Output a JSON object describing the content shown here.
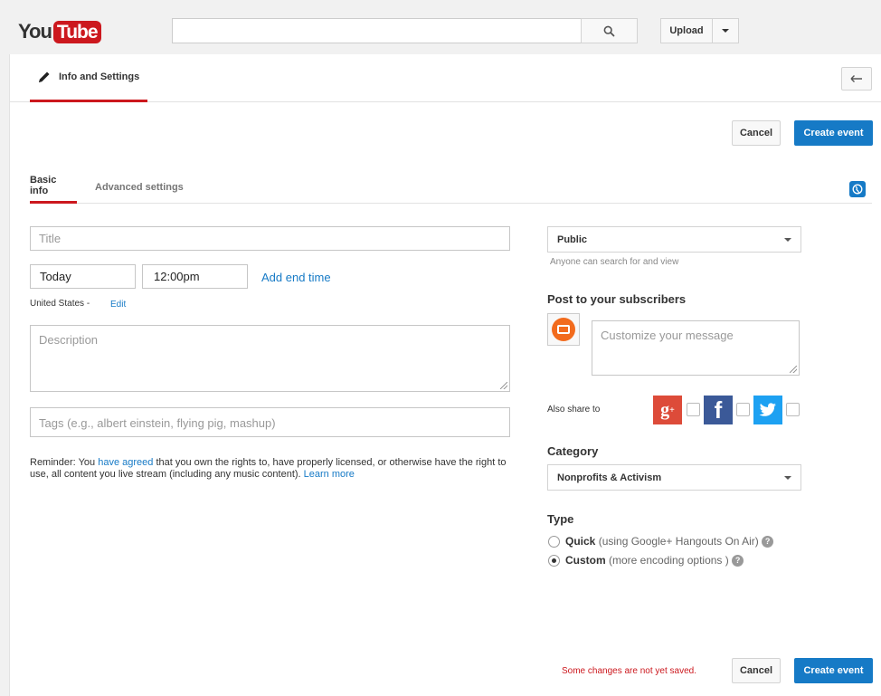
{
  "masthead": {
    "logo_you": "You",
    "logo_tube": "Tube",
    "search_placeholder": "",
    "upload_label": "Upload"
  },
  "topbar": {
    "tab_label": "Info and Settings"
  },
  "actions": {
    "cancel_label": "Cancel",
    "create_label": "Create event",
    "unsaved_warning": "Some changes are not yet saved."
  },
  "subtabs": {
    "basic": "Basic info",
    "advanced": "Advanced settings"
  },
  "form": {
    "title_placeholder": "Title",
    "date_value": "Today",
    "time_value": "12:00pm",
    "add_end_time": "Add end time",
    "timezone": "United States -",
    "edit_label": "Edit",
    "description_placeholder": "Description",
    "tags_placeholder": "Tags (e.g., albert einstein, flying pig, mashup)",
    "reminder_prefix": "Reminder: You ",
    "reminder_link": "have agreed",
    "reminder_suffix": " that you own the rights to, have properly licensed, or otherwise have the right to use, all content you live stream (including any music content). ",
    "learn_more": "Learn more"
  },
  "sidebar": {
    "privacy_value": "Public",
    "privacy_hint": "Anyone can search for and view",
    "post_title": "Post to your subscribers",
    "message_placeholder": "Customize your message",
    "also_share": "Also share to",
    "category_title": "Category",
    "category_value": "Nonprofits & Activism",
    "type_title": "Type",
    "type_quick": "Quick",
    "type_quick_hint": " (using Google+ Hangouts On Air)",
    "type_custom": "Custom",
    "type_custom_hint": " (more encoding options )",
    "selected_type": "Custom"
  },
  "colors": {
    "brand_red": "#cc181e",
    "accent_blue": "#167ac6",
    "google_plus": "#dd4b39",
    "facebook": "#3b5998",
    "twitter": "#1da1f2"
  }
}
